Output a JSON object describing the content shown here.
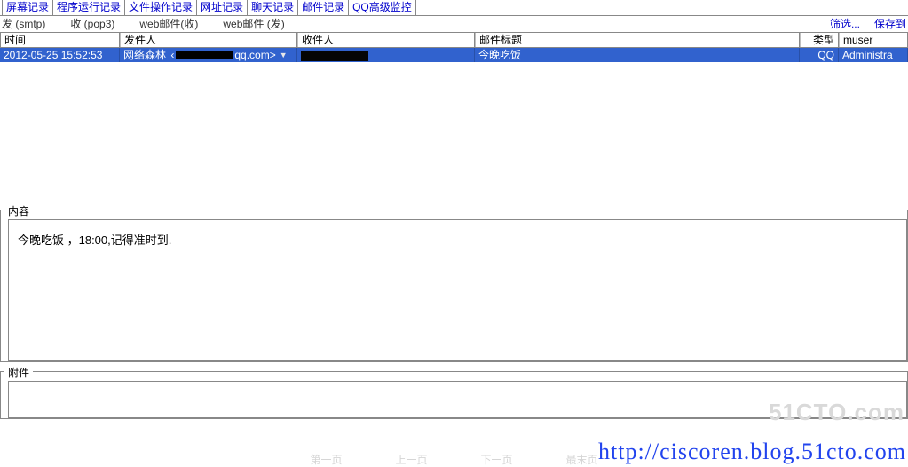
{
  "tabs": [
    {
      "label": "屏幕记录"
    },
    {
      "label": "程序运行记录"
    },
    {
      "label": "文件操作记录"
    },
    {
      "label": "网址记录"
    },
    {
      "label": "聊天记录"
    },
    {
      "label": "邮件记录"
    },
    {
      "label": "QQ高级监控"
    }
  ],
  "subtabs": [
    {
      "label": "发 (smtp)"
    },
    {
      "label": "收 (pop3)"
    },
    {
      "label": "web邮件(收)"
    },
    {
      "label": "web邮件 (发)"
    }
  ],
  "topLinks": {
    "filter": "筛选...",
    "save": "保存到"
  },
  "columns": {
    "time": "时间",
    "from": "发件人",
    "to": "收件人",
    "subject": "邮件标题",
    "type": "类型",
    "muser": "muser"
  },
  "row": {
    "time": "2012-05-25 15:52:53",
    "from_name": "网络森林",
    "from_domain": "qq.com>",
    "subject": "今晚吃饭",
    "type": "QQ",
    "muser": "Administra"
  },
  "section": {
    "content_label": "内容",
    "attach_label": "附件"
  },
  "content_body": "今晚吃饭 ，18:00,记得准时到.",
  "watermark": "51CTO.com",
  "url": "http://ciscoren.blog.51cto.com",
  "pager": {
    "first": "第一页",
    "prev": "上一页",
    "next": "下一页",
    "last": "最末页"
  }
}
